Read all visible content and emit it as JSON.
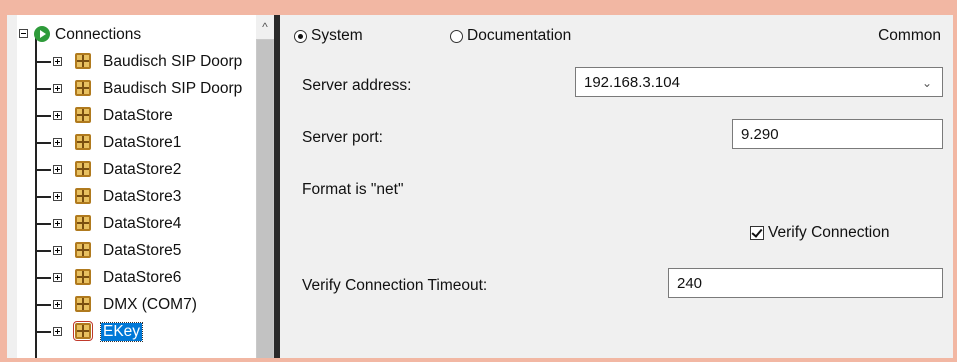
{
  "tree": {
    "root_label": "Connections",
    "items": [
      {
        "label": "Baudisch SIP Doorp"
      },
      {
        "label": "Baudisch SIP Doorp"
      },
      {
        "label": "DataStore"
      },
      {
        "label": "DataStore1"
      },
      {
        "label": "DataStore2"
      },
      {
        "label": "DataStore3"
      },
      {
        "label": "DataStore4"
      },
      {
        "label": "DataStore5"
      },
      {
        "label": "DataStore6"
      },
      {
        "label": "DMX (COM7)"
      },
      {
        "label": "EKey",
        "selected": true
      }
    ]
  },
  "scrollbar": {
    "up_arrow": "^"
  },
  "view_options": {
    "system_label": "System",
    "documentation_label": "Documentation",
    "selected": "System",
    "section_label": "Common"
  },
  "form": {
    "server_address_label": "Server address:",
    "server_address_value": "192.168.3.104",
    "server_port_label": "Server port:",
    "server_port_value": "9.290",
    "format_text": "Format is \"net\"",
    "verify_connection_label": "Verify Connection",
    "verify_connection_checked": true,
    "timeout_label": "Verify Connection Timeout:",
    "timeout_value": "240"
  },
  "colors": {
    "background_border": "#f2b7a3",
    "selection": "#0078d7",
    "play_icon": "#2e9b3a",
    "datastore_icon": "#e8c060"
  },
  "icons": {
    "root": "play-circle-icon",
    "item": "datastore-grid-icon",
    "expander": "plus-box-icon"
  }
}
